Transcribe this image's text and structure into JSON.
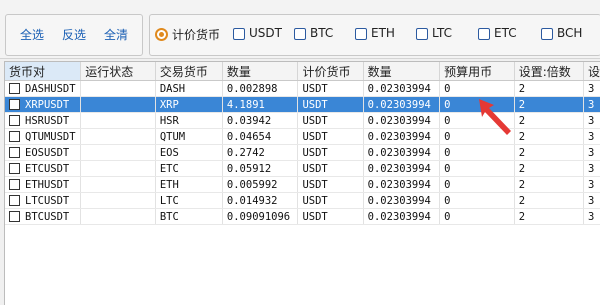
{
  "toolbar": {
    "buttons": [
      "全选",
      "反选",
      "全清"
    ],
    "quote_currency_label": "计价货币",
    "currency_options": [
      "USDT",
      "BTC",
      "ETH",
      "LTC",
      "ETC",
      "BCH"
    ]
  },
  "table": {
    "columns": [
      "货币对",
      "运行状态",
      "交易货币",
      "数量",
      "计价货币",
      "数量",
      "预算用币",
      "设置:倍数",
      "设"
    ],
    "rows": [
      [
        "DASHUSDT",
        "",
        "DASH",
        "0.002898",
        "USDT",
        "0.02303994",
        "0",
        "2",
        "3"
      ],
      [
        "XRPUSDT",
        "",
        "XRP",
        "4.1891",
        "USDT",
        "0.02303994",
        "0",
        "2",
        "3"
      ],
      [
        "HSRUSDT",
        "",
        "HSR",
        "0.03942",
        "USDT",
        "0.02303994",
        "0",
        "2",
        "3"
      ],
      [
        "QTUMUSDT",
        "",
        "QTUM",
        "0.04654",
        "USDT",
        "0.02303994",
        "0",
        "2",
        "3"
      ],
      [
        "EOSUSDT",
        "",
        "EOS",
        "0.2742",
        "USDT",
        "0.02303994",
        "0",
        "2",
        "3"
      ],
      [
        "ETCUSDT",
        "",
        "ETC",
        "0.05912",
        "USDT",
        "0.02303994",
        "0",
        "2",
        "3"
      ],
      [
        "ETHUSDT",
        "",
        "ETH",
        "0.005992",
        "USDT",
        "0.02303994",
        "0",
        "2",
        "3"
      ],
      [
        "LTCUSDT",
        "",
        "LTC",
        "0.014932",
        "USDT",
        "0.02303994",
        "0",
        "2",
        "3"
      ],
      [
        "BTCUSDT",
        "",
        "BTC",
        "0.09091096",
        "USDT",
        "0.02303994",
        "0",
        "2",
        "3"
      ]
    ],
    "selected_row": 1
  },
  "colors": {
    "accent": "#1a5fb4",
    "selection": "#3a86d6",
    "radio": "#e08a1e",
    "annotation_arrow": "#e53935"
  }
}
